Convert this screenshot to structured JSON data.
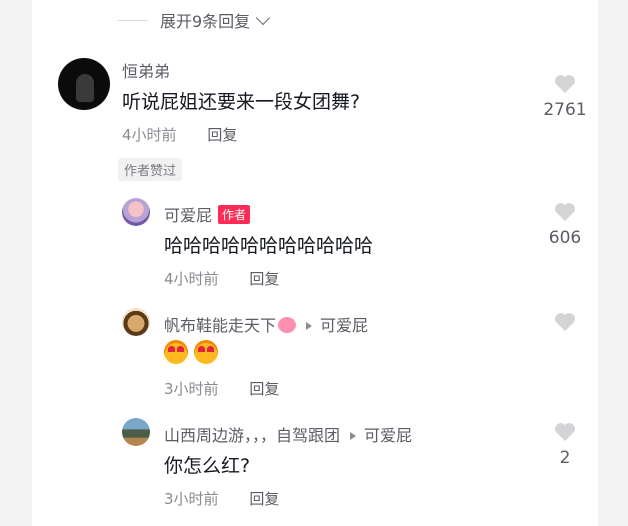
{
  "thread": {
    "expand_label": "展开9条回复"
  },
  "main_comment": {
    "username": "恒弟弟",
    "text": "听说屁姐还要来一段女团舞?",
    "time": "4小时前",
    "reply_label": "回复",
    "like_count": "2761",
    "author_liked": "作者赞过"
  },
  "replies": [
    {
      "username": "可爱屁",
      "badge": "作者",
      "text": "哈哈哈哈哈哈哈哈哈哈哈",
      "time": "4小时前",
      "reply_label": "回复",
      "like_count": "606"
    },
    {
      "username": "帆布鞋能走天下",
      "reply_to": "可爱屁",
      "text": "",
      "emojis": [
        "heart-eyes-emoji",
        "heart-eyes-emoji"
      ],
      "time": "3小时前",
      "reply_label": "回复",
      "like_count": ""
    },
    {
      "username": "山西周边游，，，自驾跟团",
      "reply_to": "可爱屁",
      "text": "你怎么红?",
      "time": "3小时前",
      "reply_label": "回复",
      "like_count": "2"
    }
  ],
  "colors": {
    "accent": "#fe2c55",
    "heart_outline": "#cfcfd2",
    "text_primary": "#161823",
    "text_secondary": "#5b5d66"
  }
}
